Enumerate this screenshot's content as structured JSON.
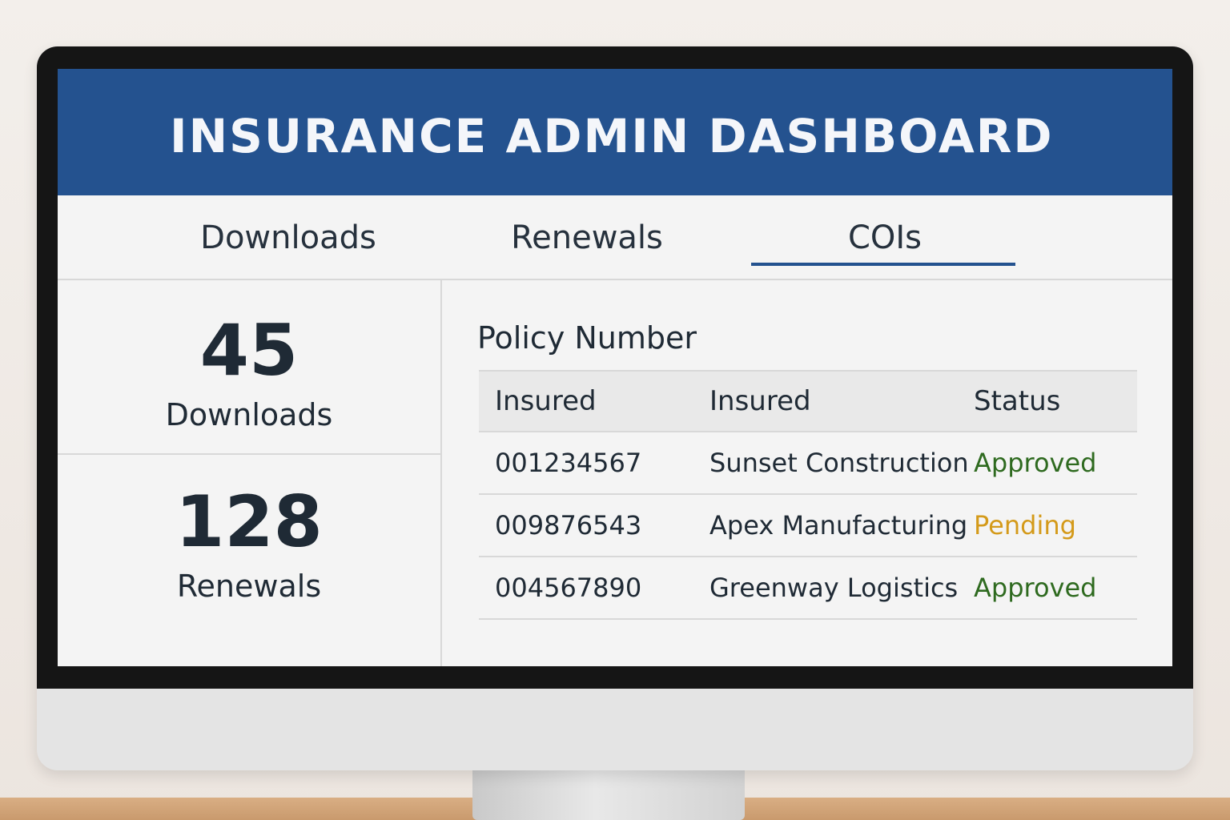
{
  "app": {
    "title": "INSURANCE ADMIN DASHBOARD"
  },
  "tabs": [
    {
      "label": "Downloads",
      "active": false
    },
    {
      "label": "Renewals",
      "active": false
    },
    {
      "label": "COIs",
      "active": true
    }
  ],
  "stats": [
    {
      "value": "45",
      "label": "Downloads"
    },
    {
      "value": "128",
      "label": "Renewals"
    }
  ],
  "table": {
    "title": "Policy Number",
    "headers": [
      "Insured",
      "Insured",
      "Status"
    ],
    "rows": [
      {
        "policy": "001234567",
        "insured": "Sunset Construction",
        "status": "Approved",
        "status_color": "#2e6a1f"
      },
      {
        "policy": "009876543",
        "insured": "Apex Manufacturing",
        "status": "Pending",
        "status_color": "#d49a1a"
      },
      {
        "policy": "004567890",
        "insured": "Greenway Logistics",
        "status": "Approved",
        "status_color": "#2e6a1f"
      }
    ]
  },
  "colors": {
    "header": "#24528f",
    "accent": "#24528f"
  }
}
